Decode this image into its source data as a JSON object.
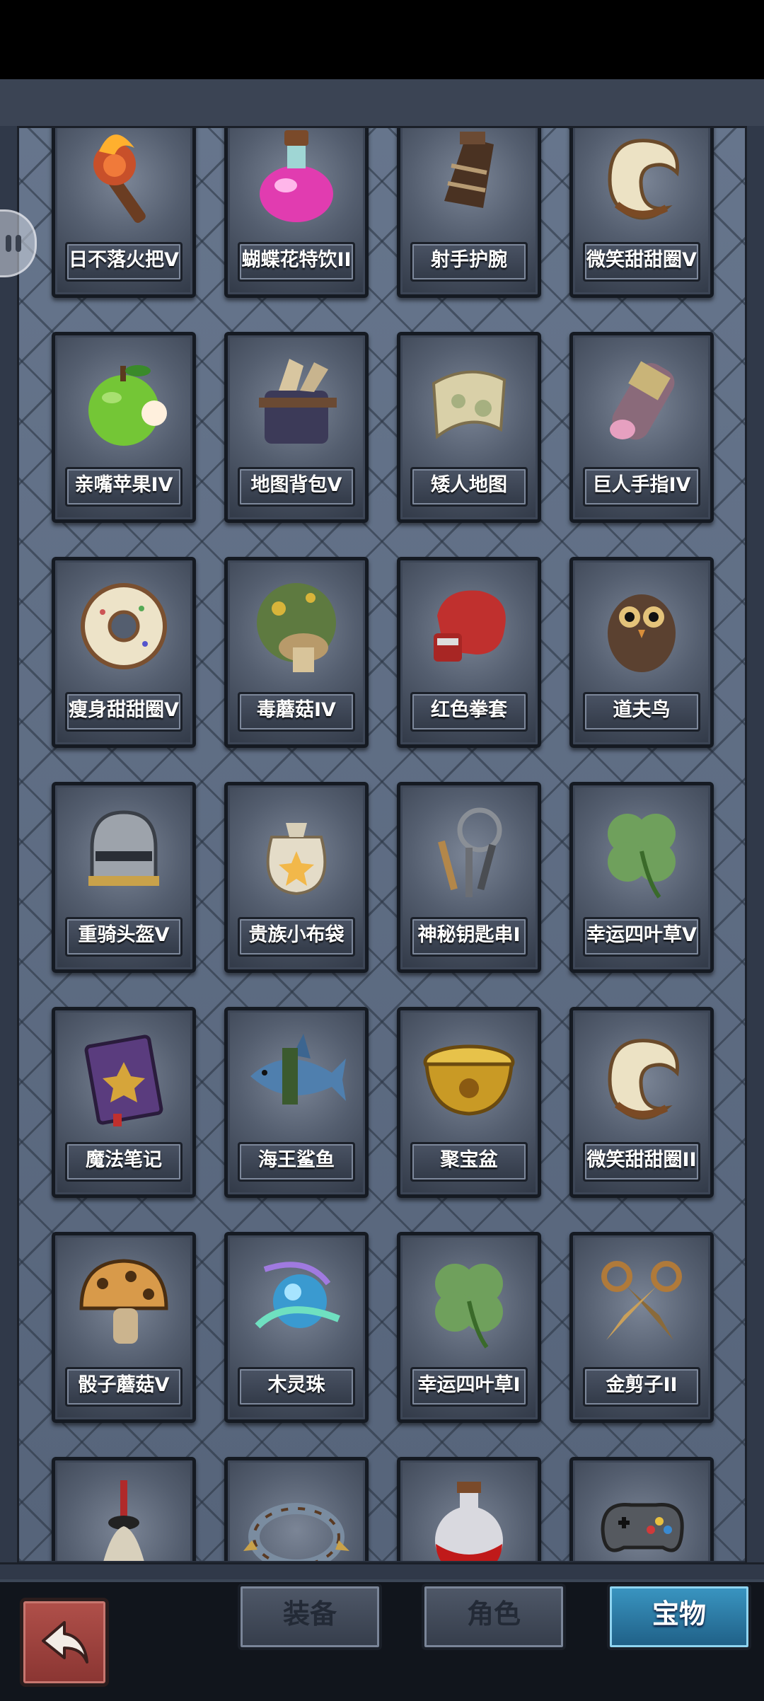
{
  "items": [
    {
      "label": "日不落火把V",
      "icon": "torch-icon"
    },
    {
      "label": "蝴蝶花特饮II",
      "icon": "potion-icon"
    },
    {
      "label": "射手护腕",
      "icon": "bracer-icon"
    },
    {
      "label": "微笑甜甜圈V",
      "icon": "croissant-donut-icon"
    },
    {
      "label": "亲嘴苹果IV",
      "icon": "apple-icon"
    },
    {
      "label": "地图背包V",
      "icon": "map-bag-icon"
    },
    {
      "label": "矮人地图",
      "icon": "scroll-map-icon"
    },
    {
      "label": "巨人手指IV",
      "icon": "giant-finger-icon"
    },
    {
      "label": "瘦身甜甜圈V",
      "icon": "donut-icon"
    },
    {
      "label": "毒蘑菇IV",
      "icon": "poison-mushroom-icon"
    },
    {
      "label": "红色拳套",
      "icon": "boxing-glove-icon"
    },
    {
      "label": "道夫鸟",
      "icon": "owl-icon"
    },
    {
      "label": "重骑头盔V",
      "icon": "helmet-icon"
    },
    {
      "label": "贵族小布袋",
      "icon": "pouch-icon"
    },
    {
      "label": "神秘钥匙串I",
      "icon": "keys-icon"
    },
    {
      "label": "幸运四叶草V",
      "icon": "clover-icon"
    },
    {
      "label": "魔法笔记",
      "icon": "spellbook-icon"
    },
    {
      "label": "海王鲨鱼",
      "icon": "shark-icon"
    },
    {
      "label": "聚宝盆",
      "icon": "treasure-bowl-icon"
    },
    {
      "label": "微笑甜甜圈II",
      "icon": "croissant-donut-icon"
    },
    {
      "label": "骰子蘑菇V",
      "icon": "dice-mushroom-icon"
    },
    {
      "label": "木灵珠",
      "icon": "spirit-orb-icon"
    },
    {
      "label": "幸运四叶草I",
      "icon": "clover-icon"
    },
    {
      "label": "金剪子II",
      "icon": "scissors-icon"
    },
    {
      "label": "",
      "icon": "mop-icon"
    },
    {
      "label": "",
      "icon": "spiked-band-icon"
    },
    {
      "label": "",
      "icon": "red-potion-icon"
    },
    {
      "label": "",
      "icon": "gamepad-icon"
    }
  ],
  "tabs": {
    "equipment": "装备",
    "character": "角色",
    "treasure": "宝物"
  },
  "colors": {
    "active_tab": "#2f7fae",
    "back_button": "#a2443f"
  }
}
